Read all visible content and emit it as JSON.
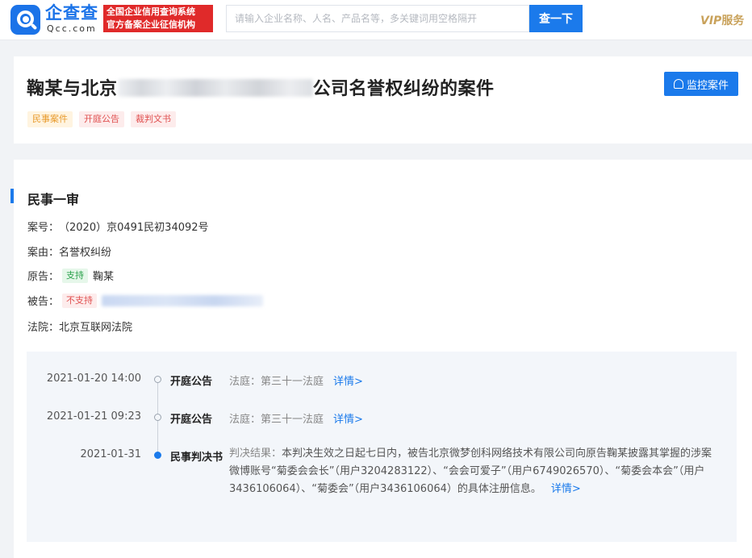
{
  "header": {
    "brand_cn": "企查查",
    "brand_en": "Qcc.com",
    "slogan_line1": "全国企业信用查询系统",
    "slogan_line2": "官方备案企业征信机构",
    "search_placeholder": "请输入企业名称、人名、产品名等，多关键词用空格隔开",
    "search_button": "查一下",
    "vip_label": "VIP",
    "vip_service": "服务"
  },
  "case": {
    "title_prefix": "鞠某与北京",
    "title_suffix": "公司名誉权纠纷的案件",
    "monitor_button": "监控案件",
    "tags": [
      "民事案件",
      "开庭公告",
      "裁判文书"
    ]
  },
  "detail": {
    "section_title": "民事一审",
    "case_no_label": "案号：",
    "case_no": "（2020）京0491民初34092号",
    "cause_label": "案由：",
    "cause": "名誉权纠纷",
    "plaintiff_label": "原告：",
    "plaintiff_tag": "支持",
    "plaintiff": "鞠某",
    "defendant_label": "被告：",
    "defendant_tag": "不支持",
    "court_label": "法院：",
    "court": "北京互联网法院"
  },
  "timeline": [
    {
      "date": "2021-01-20 14:00",
      "type": "开庭公告",
      "desc": "法庭：第三十一法庭",
      "link": "详情>"
    },
    {
      "date": "2021-01-21 09:23",
      "type": "开庭公告",
      "desc": "法庭：第三十一法庭",
      "link": "详情>"
    },
    {
      "date": "2021-01-31",
      "type": "民事判决书",
      "result_label": "判决结果：",
      "result_text": "本判决生效之日起七日内，被告北京微梦创科网络技术有限公司向原告鞠某披露其掌握的涉案微博账号“菊委会会长”（用户3204283122）、“会会可爱子”（用户6749026570）、“菊委会本会”（用户3436106064）、“菊委会”（用户3436106064）的具体注册信息。",
      "link": "详情>"
    }
  ],
  "colors": {
    "brand_blue": "#1b7aeb",
    "slogan_red": "#e02a2a",
    "vip_gold": "#c9a25b"
  }
}
